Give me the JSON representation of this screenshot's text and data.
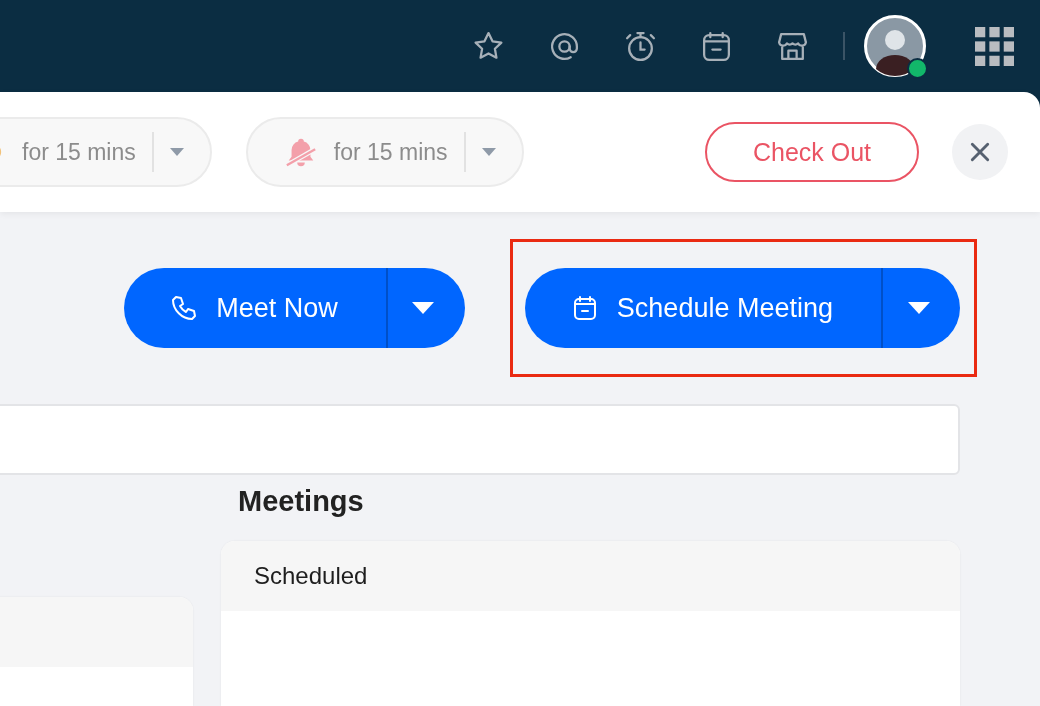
{
  "top_bar": {
    "avatar": {
      "online": true
    }
  },
  "status_pills": [
    {
      "kind": "break",
      "label": "for 15 mins"
    },
    {
      "kind": "mute",
      "label": "for 15 mins"
    }
  ],
  "check_out": "Check Out",
  "actions": [
    {
      "kind": "call",
      "label": "Meet Now",
      "highlighted": false
    },
    {
      "kind": "schedule",
      "label": "Schedule Meeting",
      "highlighted": true
    }
  ],
  "meetings": {
    "title": "Meetings",
    "card_header": "Scheduled"
  }
}
